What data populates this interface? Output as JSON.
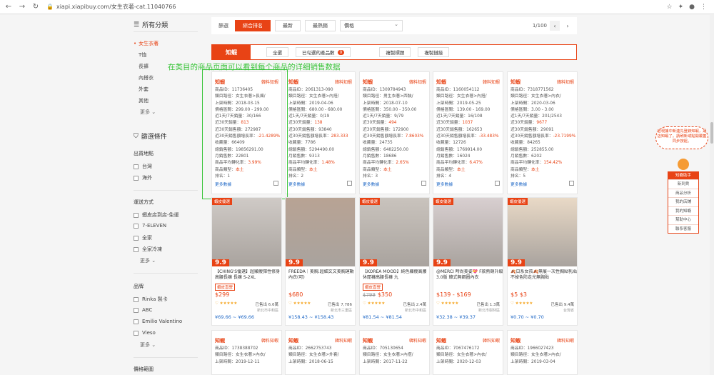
{
  "browser": {
    "url": "xiapi.xiapibuy.com/女生衣著-cat.11040766"
  },
  "sidebar": {
    "all_categories": "所有分類",
    "categories": [
      "女生衣著",
      "T恤",
      "長褲",
      "內搭衣",
      "外套",
      "其他"
    ],
    "more": "更多",
    "filter_title": "篩選條件",
    "ship_from_title": "出貨地點",
    "ship_from": [
      "台灣",
      "海外"
    ],
    "shipping_title": "運送方式",
    "shipping": [
      "蝦皮店到店-免運",
      "7-ELEVEN",
      "全家",
      "全家冷凍"
    ],
    "brand_title": "品牌",
    "brands": [
      "Rinka 製卡",
      "ABC",
      "Emilio Valentino",
      "Vieso"
    ],
    "price_title": "價格範圍"
  },
  "filterbar": {
    "label": "篩選",
    "buttons": [
      "綜合排名",
      "最新",
      "最熱銷"
    ],
    "price_select": "價格",
    "page": "1/100"
  },
  "zxbar": {
    "logo": "知蝦",
    "tabs": [
      "全選",
      "已勾選的產品數",
      "複製標題",
      "複製鏈接"
    ],
    "count": "0"
  },
  "annotation": "在类目的商品页面可以看到每个商品的详细销售数据",
  "cards": [
    {
      "id": "11736405",
      "cat": "女生衣著>長褲/",
      "date": "2018-03-15",
      "price": "299.00 - 299.00",
      "sales30": "30/166",
      "sales30d": "813",
      "rev30": "272987",
      "growth": "-21.4289%",
      "fav": "66409",
      "total": "19856291.00",
      "monthly": "22801",
      "conv": "3.99%",
      "shop": "本土",
      "rank": "1"
    },
    {
      "id": "2061313-090",
      "cat": "女生衣著>內搭/",
      "date": "2019-04-06",
      "price": "680.00 - 680.00",
      "sales30": "0/19",
      "sales30d": "138",
      "rev30": "93840",
      "growth": "283.333",
      "fav": "7786",
      "total": "5294490.00",
      "monthly": "9313",
      "conv": "1.48%",
      "shop": "本土",
      "rank": "2"
    },
    {
      "id": "1309784943",
      "cat": "男生衣著>西裝/",
      "date": "2018-07-10",
      "price": "350.00 - 350.00",
      "sales30": "9/79",
      "sales30d": "494",
      "rev30": "172900",
      "growth": "7.8603%",
      "fav": "24735",
      "total": "6482250.00",
      "monthly": "18686",
      "conv": "2.65%",
      "shop": "本土",
      "rank": "3"
    },
    {
      "id": "1160054112",
      "cat": "女生衣著>內搭/",
      "date": "2019-05-25",
      "price": "139.00 - 169.00",
      "sales30": "16/108",
      "sales30d": "1037",
      "rev30": "162653",
      "growth": "-33.483%",
      "fav": "12726",
      "total": "1769914.00",
      "monthly": "16024",
      "conv": "6.47%",
      "shop": "本土",
      "rank": "4"
    },
    {
      "id": "7318771562",
      "cat": "女生衣著>內衣/",
      "date": "2020-03-06",
      "price": "3.00 - 3.00",
      "sales30": "201/2543",
      "sales30d": "9677",
      "rev30": "29091",
      "growth": "-23.7199%",
      "fav": "84265",
      "total": "252855.00",
      "monthly": "6202",
      "conv": "154.42%",
      "shop": "本土",
      "rank": "5"
    }
  ],
  "card_labels": {
    "id": "商品ID：",
    "cat": "類目路徑：",
    "date": "上架時間：",
    "price": "價格區間：",
    "sales30": "近1天/7天銷量：",
    "sales30d": "近30天銷量：",
    "rev30": "近30天銷售額：",
    "growth": "近30天銷售額增長率：",
    "fav": "收藏量：",
    "total": "總銷售額：",
    "monthly": "月銷售數：",
    "conv": "商品平均轉化率：",
    "shop": "商品類型：",
    "rank": "排名：",
    "more": "更多數據",
    "zx": "韓料知蝦"
  },
  "products": [
    {
      "tag": "蝦皮優選",
      "title": "【CHING'S優選】超顯瘦彈性修身高腰長褲 長褲 S-2XL",
      "badge": "蝦皮直營",
      "price": "$299",
      "old": "",
      "sold": "已售出 6.6萬",
      "loc": "新北市中和區",
      "range": "¥69.66 ~ ¥69.66"
    },
    {
      "tag": "",
      "title": "FREEDA｜美胸.超細文文美胸運動內衣(可)",
      "badge": "",
      "price": "$680",
      "old": "",
      "sold": "已售出 7,786",
      "loc": "新北市三重區",
      "range": "¥158.43 ~ ¥158.43"
    },
    {
      "tag": "蝦皮優選",
      "title": "【KOREA MOOD】純色顯瘦高腰休閒褲高腰長褲 九",
      "badge": "蝦皮直營",
      "price": "$350",
      "old": "$799",
      "sold": "已售出 2.4萬",
      "loc": "新北市中和區",
      "range": "¥81.54 ~ ¥81.54"
    },
    {
      "tag": "蝦皮優選",
      "title": "@MERCI 時尚美姿💝 F款熱銷升級3.0版 韓式無鋼圈內衣",
      "badge": "",
      "price": "$139 - $169",
      "old": "",
      "sold": "已售出 1.3萬",
      "loc": "新北市樹林區",
      "range": "¥32.38 ~ ¥39.37"
    },
    {
      "tag": "蝦皮優選",
      "title": "🍂日系女孩🍂無痕一次性胸貼乳貼 不掉色防走光無胸貼",
      "badge": "",
      "price": "$5 $3",
      "old": "",
      "sold": "已售出 9.4萬",
      "loc": "台灣省",
      "range": "¥0.70 ~ ¥0.70"
    }
  ],
  "bottom_cards": [
    {
      "id": "1738388702",
      "cat": "女生衣著>內衣/",
      "date": "2019-12-11"
    },
    {
      "id": "2662753743",
      "cat": "女生衣著>外套/",
      "date": "2018-06-15"
    },
    {
      "id": "705130654",
      "cat": "女生衣著>內搭/",
      "date": "2017-11-22"
    },
    {
      "id": "7067476172",
      "cat": "女生衣著>內衣/",
      "date": "2020-12-03"
    },
    {
      "id": "1966027423",
      "cat": "女生衣著>內衣/",
      "date": "2019-03-04"
    }
  ],
  "float": {
    "note": "店現捕中新連先登錄知蝦，是店知蝦了。請刷新或點開覆蓋同步按鈕。",
    "panel_title": "知蝦助手",
    "panel_items": [
      "新到貨",
      "商品分析",
      "我的店鋪",
      "我的知蝦",
      "幫助中心",
      "聯系客服"
    ]
  }
}
